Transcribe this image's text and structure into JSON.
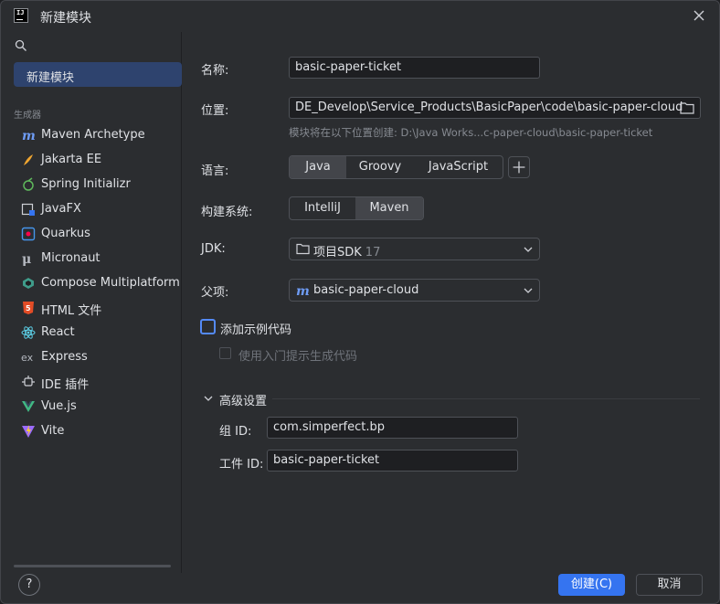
{
  "window": {
    "title": "新建模块"
  },
  "sidebar": {
    "selected": "新建模块",
    "generators_label": "生成器",
    "generators": [
      {
        "label": "Maven Archetype",
        "icon": "maven-icon"
      },
      {
        "label": "Jakarta EE",
        "icon": "jakarta-ee-icon"
      },
      {
        "label": "Spring Initializr",
        "icon": "spring-icon"
      },
      {
        "label": "JavaFX",
        "icon": "javafx-icon"
      },
      {
        "label": "Quarkus",
        "icon": "quarkus-icon"
      },
      {
        "label": "Micronaut",
        "icon": "micronaut-icon"
      },
      {
        "label": "Compose Multiplatform",
        "icon": "compose-icon"
      },
      {
        "label": "HTML 文件",
        "icon": "html5-icon"
      },
      {
        "label": "React",
        "icon": "react-icon"
      },
      {
        "label": "Express",
        "icon": "express-icon"
      },
      {
        "label": "IDE 插件",
        "icon": "plugin-icon"
      },
      {
        "label": "Vue.js",
        "icon": "vue-icon"
      },
      {
        "label": "Vite",
        "icon": "vite-icon"
      }
    ]
  },
  "form": {
    "name_label": "名称:",
    "name_value": "basic-paper-ticket",
    "location_label": "位置:",
    "location_value": "DE_Develop\\Service_Products\\BasicPaper\\code\\basic-paper-cloud",
    "location_hint": "模块将在以下位置创建: D:\\Java Works...c-paper-cloud\\basic-paper-ticket",
    "language_label": "语言:",
    "languages": [
      "Java",
      "Groovy",
      "JavaScript"
    ],
    "language_selected": "Java",
    "build_label": "构建系统:",
    "build_systems": [
      "IntelliJ",
      "Maven"
    ],
    "build_selected": "Maven",
    "jdk_label": "JDK:",
    "jdk_name": "项目SDK",
    "jdk_version": "17",
    "parent_label": "父项:",
    "parent_value": "basic-paper-cloud",
    "sample_code_label": "添加示例代码",
    "onboarding_label": "使用入门提示生成代码",
    "advanced_label": "高级设置",
    "group_label": "组 ID:",
    "group_value": "com.simperfect.bp",
    "artifact_label": "工件 ID:",
    "artifact_value": "basic-paper-ticket"
  },
  "footer": {
    "help": "?",
    "create": "创建(C)",
    "cancel": "取消"
  },
  "colors": {
    "accent": "#3574f0",
    "selection": "#2e436e",
    "background": "#2b2d30",
    "field": "#1e1f22"
  }
}
